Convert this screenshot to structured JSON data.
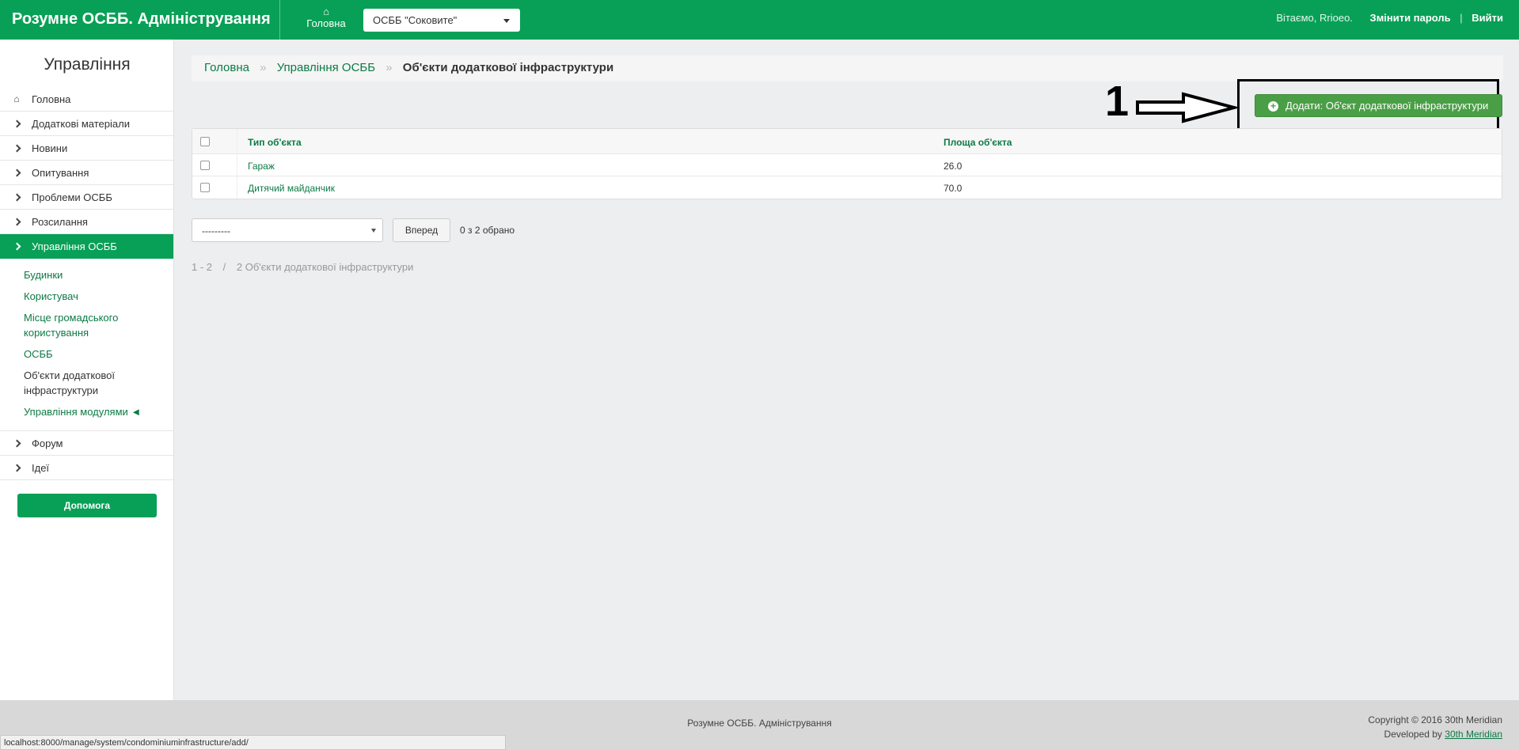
{
  "header": {
    "brand": "Розумне ОСББ. Адміністрування",
    "home_label": "Головна",
    "osbb_select": "ОСББ \"Соковите\"",
    "greeting": "Вітаємо, Rrioeo.",
    "change_password": "Змінити пароль",
    "separator": "|",
    "logout": "Вийти"
  },
  "sidebar": {
    "title": "Управління",
    "items": [
      {
        "label": "Головна",
        "icon": "home-icon"
      },
      {
        "label": "Додаткові матеріали",
        "icon": "chevron-right-icon"
      },
      {
        "label": "Новини",
        "icon": "chevron-right-icon"
      },
      {
        "label": "Опитування",
        "icon": "chevron-right-icon"
      },
      {
        "label": "Проблеми ОСББ",
        "icon": "chevron-right-icon"
      },
      {
        "label": "Розсилання",
        "icon": "chevron-right-icon"
      },
      {
        "label": "Управління ОСББ",
        "icon": "chevron-right-icon",
        "active": true
      }
    ],
    "subitems": [
      {
        "label": "Будинки"
      },
      {
        "label": "Користувач"
      },
      {
        "label": "Місце громадського користування"
      },
      {
        "label": "ОСББ"
      },
      {
        "label": "Об'єкти додаткової інфраструктури",
        "current": true
      },
      {
        "label": "Управління модулями ◄"
      }
    ],
    "items_after": [
      {
        "label": "Форум",
        "icon": "chevron-right-icon"
      },
      {
        "label": "Ідеї",
        "icon": "chevron-right-icon"
      }
    ],
    "help_button": "Допомога"
  },
  "breadcrumb": {
    "items": [
      "Головна",
      "Управління ОСББ"
    ],
    "separator": "»",
    "current": "Об'єкти додаткової інфраструктури"
  },
  "add_button": "Додати: Об'єкт додаткової інфраструктури",
  "annotation_number": "1",
  "table": {
    "columns": [
      "Тип об'єкта",
      "Площа об'єкта"
    ],
    "rows": [
      {
        "type": "Гараж",
        "area": "26.0"
      },
      {
        "type": "Дитячий майданчик",
        "area": "70.0"
      }
    ]
  },
  "actions": {
    "select_value": "---------",
    "go_button": "Вперед",
    "selected_count": "0 з 2 обрано"
  },
  "paginator": {
    "range": "1 - 2",
    "separator": "/",
    "total": "2 Об'єкти додаткової інфраструктури"
  },
  "footer": {
    "center": "Розумне ОСББ. Адміністрування",
    "copyright": "Copyright © 2016 30th Meridian",
    "developed_by": "Developed by",
    "developer": "30th Meridian"
  },
  "statusbar": "localhost:8000/manage/system/condominiuminfrastructure/add/",
  "colors": {
    "brand_green": "#08a056",
    "add_button_green": "#4a9f46",
    "link_green": "#0c7a46"
  }
}
